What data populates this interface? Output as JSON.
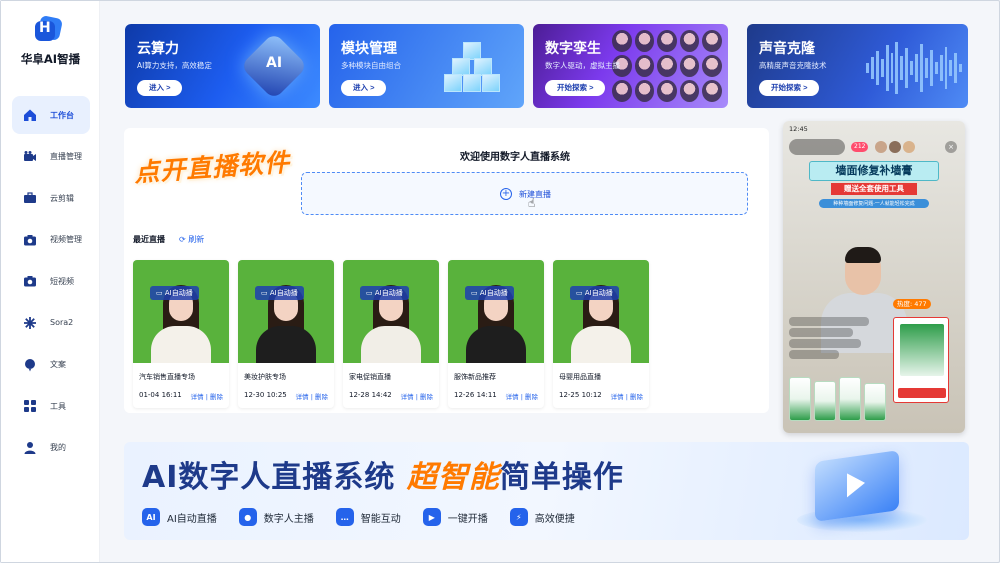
{
  "app": {
    "brand": "华阜AI智播",
    "logo_letter": "H"
  },
  "sidebar": {
    "items": [
      {
        "label": "工作台",
        "icon": "home-icon",
        "active": true
      },
      {
        "label": "直播管理",
        "icon": "video-camera-icon"
      },
      {
        "label": "云剪辑",
        "icon": "briefcase-icon"
      },
      {
        "label": "视频管理",
        "icon": "camera-icon"
      },
      {
        "label": "短视频",
        "icon": "camera-icon"
      },
      {
        "label": "Sora2",
        "icon": "sparkle-icon"
      },
      {
        "label": "文案",
        "icon": "balloon-icon"
      },
      {
        "label": "工具",
        "icon": "grid-icon"
      },
      {
        "label": "我的",
        "icon": "user-icon"
      }
    ]
  },
  "cards": [
    {
      "title": "云算力",
      "subtitle": "AI算力支持，高效稳定",
      "button": "进入 >",
      "art": "AI"
    },
    {
      "title": "模块管理",
      "subtitle": "多种模块自由组合",
      "button": "进入 >"
    },
    {
      "title": "数字孪生",
      "subtitle": "数字人驱动，虚拟主播",
      "button": "开始探索 >"
    },
    {
      "title": "声音克隆",
      "subtitle": "高精度声音克隆技术",
      "button": "开始探索 >"
    }
  ],
  "main": {
    "promo": "点开直播软件",
    "welcome": "欢迎使用数字人直播系统",
    "new_live": "新建直播",
    "recent_label": "最近直播",
    "refresh_label": "刷新",
    "tag": "AI自动播",
    "detail": "详情",
    "delete": "删除",
    "lives": [
      {
        "title": "汽车销售直播专场",
        "date": "01-04 16:11"
      },
      {
        "title": "美妆护肤专场",
        "date": "12-30 10:25"
      },
      {
        "title": "家电促销直播",
        "date": "12-28 14:42"
      },
      {
        "title": "服饰新品推荐",
        "date": "12-26 14:11"
      },
      {
        "title": "母婴用品直播",
        "date": "12-25 10:12"
      }
    ]
  },
  "phone": {
    "time": "12:45",
    "viewers": "212",
    "headline": "墙面修复补墙膏",
    "sub": "赠送全套使用工具",
    "sub2": "种种墙面修复问题·一人就能轻松完成",
    "hot": "热度: 477"
  },
  "banner": {
    "title_a": "AI数字人直播系统",
    "title_b": "超智能",
    "title_c": "简单操作",
    "features": [
      {
        "label": "AI自动直播",
        "icon": "ai-icon",
        "glyph": "AI"
      },
      {
        "label": "数字人主播",
        "icon": "user-icon",
        "glyph": "●"
      },
      {
        "label": "智能互动",
        "icon": "chat-icon",
        "glyph": "…"
      },
      {
        "label": "一键开播",
        "icon": "play-icon",
        "glyph": "▶"
      },
      {
        "label": "高效便捷",
        "icon": "bolt-icon",
        "glyph": "⚡"
      }
    ]
  },
  "colors": {
    "accent": "#2563eb",
    "promo": "#ff7a00",
    "green_screen": "#59b23c"
  }
}
